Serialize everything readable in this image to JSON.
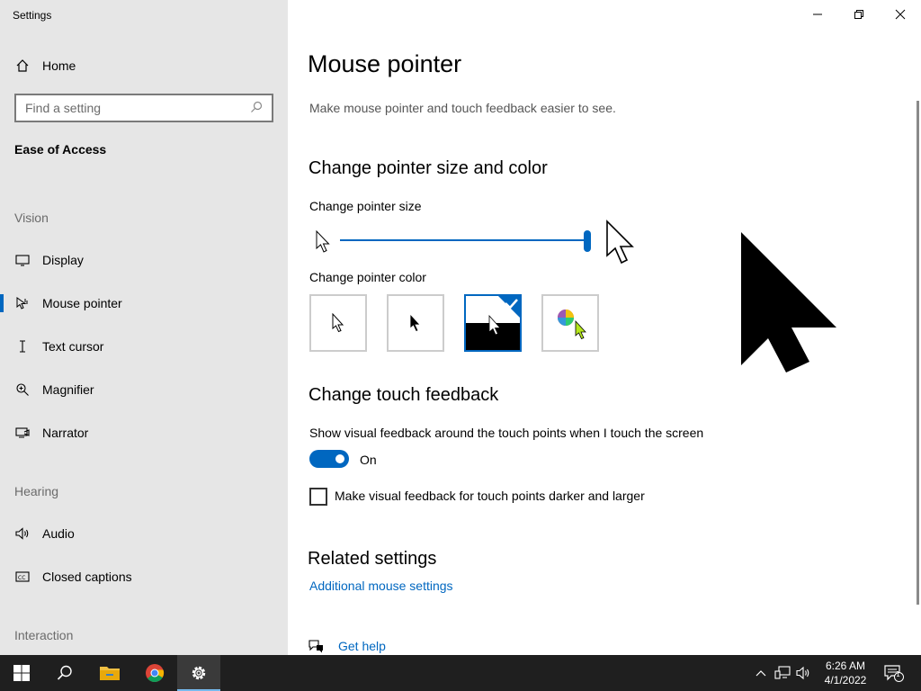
{
  "app": {
    "title": "Settings"
  },
  "sidebar": {
    "home_label": "Home",
    "search_placeholder": "Find a setting",
    "section_title": "Ease of Access",
    "groups": {
      "vision": "Vision",
      "hearing": "Hearing",
      "interaction": "Interaction"
    },
    "items": [
      {
        "label": "Display",
        "icon": "monitor-icon"
      },
      {
        "label": "Mouse pointer",
        "icon": "mouse-pointer-icon",
        "selected": true
      },
      {
        "label": "Text cursor",
        "icon": "text-cursor-icon"
      },
      {
        "label": "Magnifier",
        "icon": "magnifier-icon"
      },
      {
        "label": "Narrator",
        "icon": "narrator-icon"
      },
      {
        "label": "Audio",
        "icon": "speaker-icon"
      },
      {
        "label": "Closed captions",
        "icon": "closed-captions-icon"
      }
    ]
  },
  "main": {
    "title": "Mouse pointer",
    "description": "Make mouse pointer and touch feedback easier to see.",
    "pointer_section_title": "Change pointer size and color",
    "pointer_size_label": "Change pointer size",
    "pointer_size_value": 1.0,
    "pointer_color_label": "Change pointer color",
    "pointer_color_options": [
      "white",
      "black",
      "inverted",
      "custom"
    ],
    "pointer_color_selected": "inverted",
    "touch_section_title": "Change touch feedback",
    "touch_feedback_label": "Show visual feedback around the touch points when I touch the screen",
    "touch_feedback_toggle_state": "On",
    "darker_feedback_label": "Make visual feedback for touch points darker and larger",
    "darker_feedback_checked": false,
    "related_title": "Related settings",
    "related_link": "Additional mouse settings",
    "help_link": "Get help"
  },
  "taskbar": {
    "time": "6:26 AM",
    "date": "4/1/2022",
    "notification_count": "1",
    "accent": "#76b9ed"
  },
  "colors": {
    "accent": "#0067c0",
    "sidebar_bg": "#e6e6e6",
    "taskbar_bg": "#1f1f1f"
  }
}
